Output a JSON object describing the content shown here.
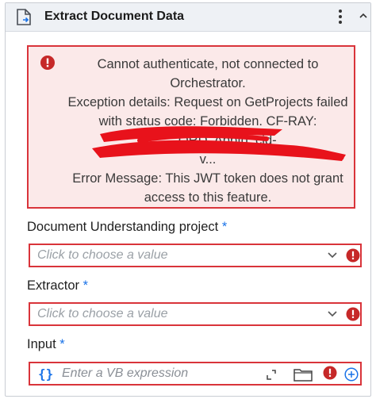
{
  "header": {
    "title": "Extract Document Data",
    "icons": {
      "activity": "document-icon",
      "menu": "vertical-ellipsis-icon",
      "collapse": "chevron-up-icon"
    }
  },
  "error": {
    "icon": "error-icon",
    "lines": [
      "Cannot authenticate, not connected to",
      "Orchestrator.",
      "Exception details: Request on GetProjects failed",
      "with status code: Forbidden. CF-RAY:",
      "8c...  ...ORD. AppId: cid-",
      "v...",
      "Error Message: This JWT token does not grant",
      "access to this feature."
    ]
  },
  "fields": {
    "project": {
      "label": "Document Understanding project",
      "required": "*",
      "placeholder": "Click to choose a value"
    },
    "extractor": {
      "label": "Extractor",
      "required": "*",
      "placeholder": "Click to choose a value"
    },
    "input": {
      "label": "Input",
      "required": "*",
      "placeholder": "Enter a VB expression",
      "prefix": "{}"
    }
  },
  "colors": {
    "error_red": "#d9343a",
    "error_bg": "#fbe9e9",
    "required_blue": "#1a73e8",
    "header_bg": "#eef1f5"
  }
}
